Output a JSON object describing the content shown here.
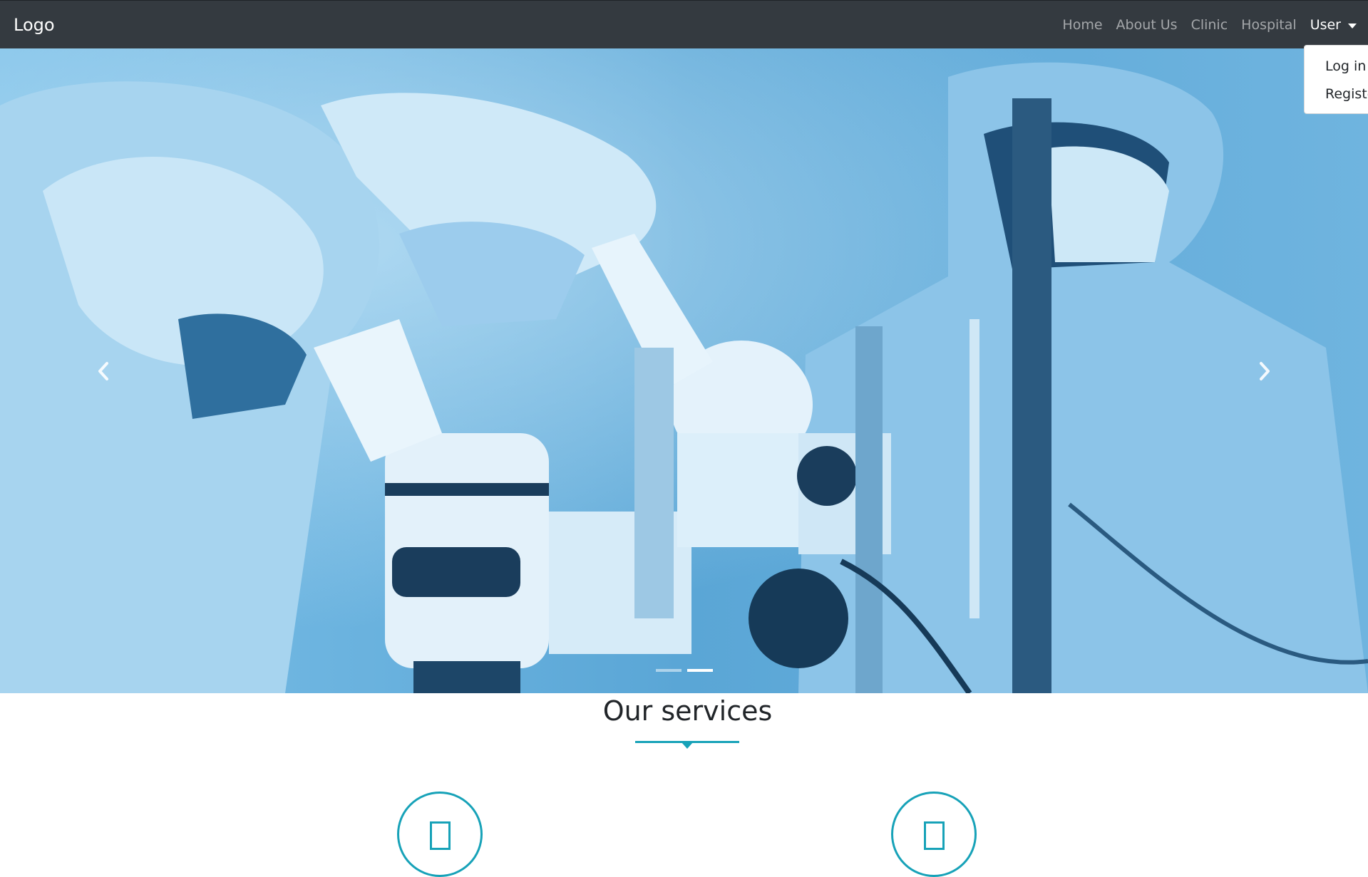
{
  "navbar": {
    "brand": "Logo",
    "links": [
      "Home",
      "About Us",
      "Clinic",
      "Hospital"
    ],
    "user_label": "User"
  },
  "dropdown": {
    "items": [
      "Log in",
      "Register"
    ]
  },
  "carousel": {
    "slide_count": 2,
    "active_slide": 2
  },
  "services": {
    "title": "Our services"
  },
  "colors": {
    "navbar_bg": "#343a40",
    "accent": "#17a2b8",
    "hero_tint": "#5ea9d9"
  }
}
